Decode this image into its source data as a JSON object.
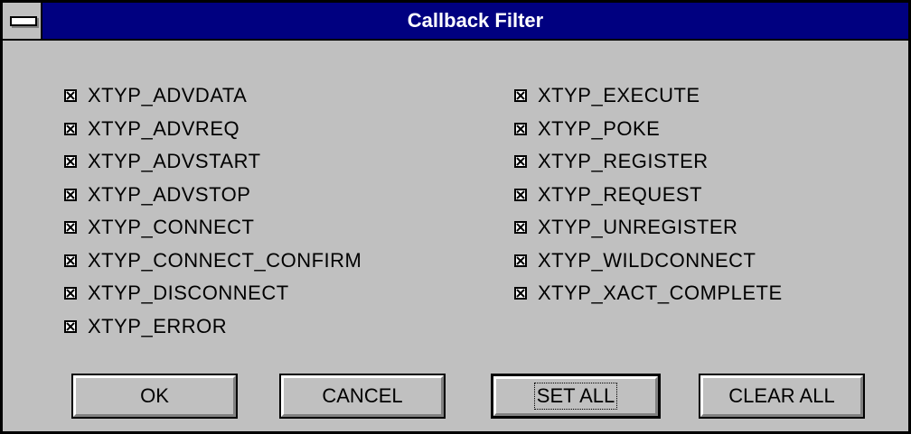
{
  "window": {
    "title": "Callback Filter"
  },
  "left_options": [
    {
      "label": "XTYP_ADVDATA",
      "checked": true
    },
    {
      "label": "XTYP_ADVREQ",
      "checked": true
    },
    {
      "label": "XTYP_ADVSTART",
      "checked": true
    },
    {
      "label": "XTYP_ADVSTOP",
      "checked": true
    },
    {
      "label": "XTYP_CONNECT",
      "checked": true
    },
    {
      "label": "XTYP_CONNECT_CONFIRM",
      "checked": true
    },
    {
      "label": "XTYP_DISCONNECT",
      "checked": true
    },
    {
      "label": "XTYP_ERROR",
      "checked": true
    }
  ],
  "right_options": [
    {
      "label": "XTYP_EXECUTE",
      "checked": true
    },
    {
      "label": "XTYP_POKE",
      "checked": true
    },
    {
      "label": "XTYP_REGISTER",
      "checked": true
    },
    {
      "label": "XTYP_REQUEST",
      "checked": true
    },
    {
      "label": "XTYP_UNREGISTER",
      "checked": true
    },
    {
      "label": "XTYP_WILDCONNECT",
      "checked": true
    },
    {
      "label": "XTYP_XACT_COMPLETE",
      "checked": true
    }
  ],
  "buttons": {
    "ok": "OK",
    "cancel": "CANCEL",
    "set_all": "SET ALL",
    "clear_all": "CLEAR ALL"
  },
  "colors": {
    "titlebar": "#000080",
    "face": "#c0c0c0"
  }
}
